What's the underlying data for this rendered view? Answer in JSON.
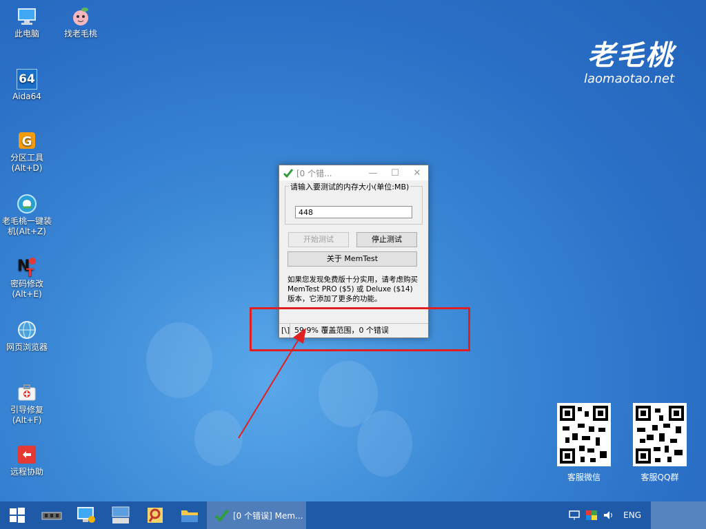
{
  "desktop": {
    "icons": [
      {
        "label": "此电脑",
        "label2": ""
      },
      {
        "label": "找老毛桃",
        "label2": ""
      },
      {
        "label": "Aida64",
        "label2": ""
      },
      {
        "label": "分区工具",
        "label2": "(Alt+D)"
      },
      {
        "label": "老毛桃一键装",
        "label2": "机(Alt+Z)"
      },
      {
        "label": "密码修改",
        "label2": "(Alt+E)"
      },
      {
        "label": "网页浏览器",
        "label2": ""
      },
      {
        "label": "引导修复",
        "label2": "(Alt+F)"
      },
      {
        "label": "远程协助",
        "label2": ""
      }
    ],
    "aida_text": "64"
  },
  "brand": {
    "cn": "老毛桃",
    "url": "laomaotao.net"
  },
  "qr": {
    "left_caption": "客服微信",
    "right_caption": "客服QQ群"
  },
  "dialog": {
    "title": "[0 个错...",
    "minimize": "—",
    "maximize": "☐",
    "close": "✕",
    "group_label": "请输入要测试的内存大小(单位:MB)",
    "input_value": "448",
    "start_button": "开始测试",
    "stop_button": "停止测试",
    "about_button": "关于 MemTest",
    "info_text": "如果您发现免费版十分实用，请考虑购买 MemTest PRO ($5) 或 Deluxe ($14) 版本，它添加了更多的功能。",
    "status_spinner": "[\\]",
    "status_text": "59.9% 覆盖范围，0 个错误"
  },
  "taskbar": {
    "active_label": "[0 个错误] Mem...",
    "lang": "ENG"
  },
  "colors": {
    "annotation": "#e02020",
    "accent": "#1f5aa8"
  }
}
